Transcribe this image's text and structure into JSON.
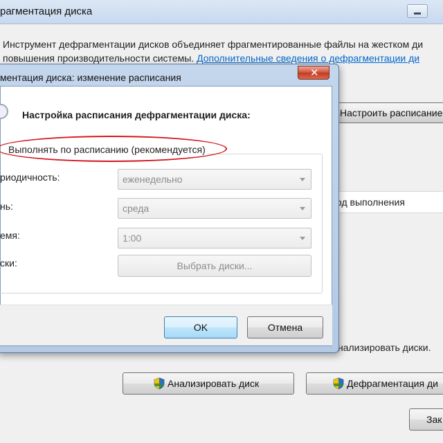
{
  "main_window": {
    "title": "рагментация диска",
    "description_line1": "Инструмент дефрагментации дисков объединяет фрагментированные файлы на жестком ди",
    "description_line2_prefix": "повышения производительности системы. ",
    "description_link": "Дополнительные сведения о дефрагментации ди",
    "configure_schedule_label": "Настроить расписание",
    "column_header_progress": "од выполнения",
    "analyze_hint": "нализировать диски.",
    "analyze_disk_label": "Анализировать диск",
    "defrag_disk_label": "Дефрагментация ди",
    "close_label": "Зак"
  },
  "dialog": {
    "title": "ментация диска: изменение расписания",
    "close_glyph": "✕",
    "heading": "Настройка расписания дефрагментации диска:",
    "run_on_schedule_label": "Выполнять по расписанию (рекомендуется)",
    "frequency_label": "риодичность:",
    "frequency_value": "еженедельно",
    "day_label": "нь:",
    "day_value": "среда",
    "time_label": "емя:",
    "time_value": "1:00",
    "disks_label": "ски:",
    "select_disks_label": "Выбрать диски...",
    "ok_label": "OK",
    "cancel_label": "Отмена"
  },
  "colors": {
    "highlight_ellipse": "#d4141c",
    "link": "#0066cc",
    "dialog_frame": "#b3c9e4"
  },
  "icons": [
    "shield-icon",
    "schedule-icon",
    "close-icon",
    "minimize-icon",
    "chevron-down-icon"
  ]
}
